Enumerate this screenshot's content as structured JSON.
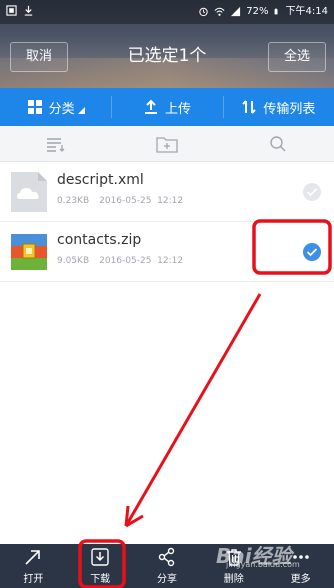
{
  "status_bar": {
    "battery": "72%",
    "time": "下午4:14"
  },
  "header": {
    "cancel_label": "取消",
    "title": "已选定1个",
    "select_all_label": "全选"
  },
  "tabs": [
    {
      "label": "分类",
      "icon": "grid-icon"
    },
    {
      "label": "上传",
      "icon": "upload-icon"
    },
    {
      "label": "传输列表",
      "icon": "transfer-icon"
    }
  ],
  "toolbar": {
    "icons": [
      "sort-list-icon",
      "new-folder-icon",
      "search-icon"
    ]
  },
  "files": [
    {
      "name": "descript.xml",
      "size": "0.23KB",
      "date": "2016-05-25",
      "time": "12:12",
      "selected": false,
      "icon": "cloud-file-icon"
    },
    {
      "name": "contacts.zip",
      "size": "9.05KB",
      "date": "2016-05-25",
      "time": "12:12",
      "selected": true,
      "icon": "zip-archive-icon"
    }
  ],
  "bottom_bar": [
    {
      "label": "打开",
      "icon": "open-arrow-icon"
    },
    {
      "label": "下载",
      "icon": "download-icon"
    },
    {
      "label": "分享",
      "icon": "share-icon"
    },
    {
      "label": "删除",
      "icon": "trash-icon"
    },
    {
      "label": "更多",
      "icon": "more-icon"
    }
  ],
  "watermark": {
    "text": "Bai经验",
    "sub": "jingyan.baidu.com"
  },
  "colors": {
    "tab_blue": "#1e86e8",
    "check_blue": "#3d8fe8",
    "annotation_red": "#e8101a",
    "bottom_bar": "#2b3545"
  }
}
